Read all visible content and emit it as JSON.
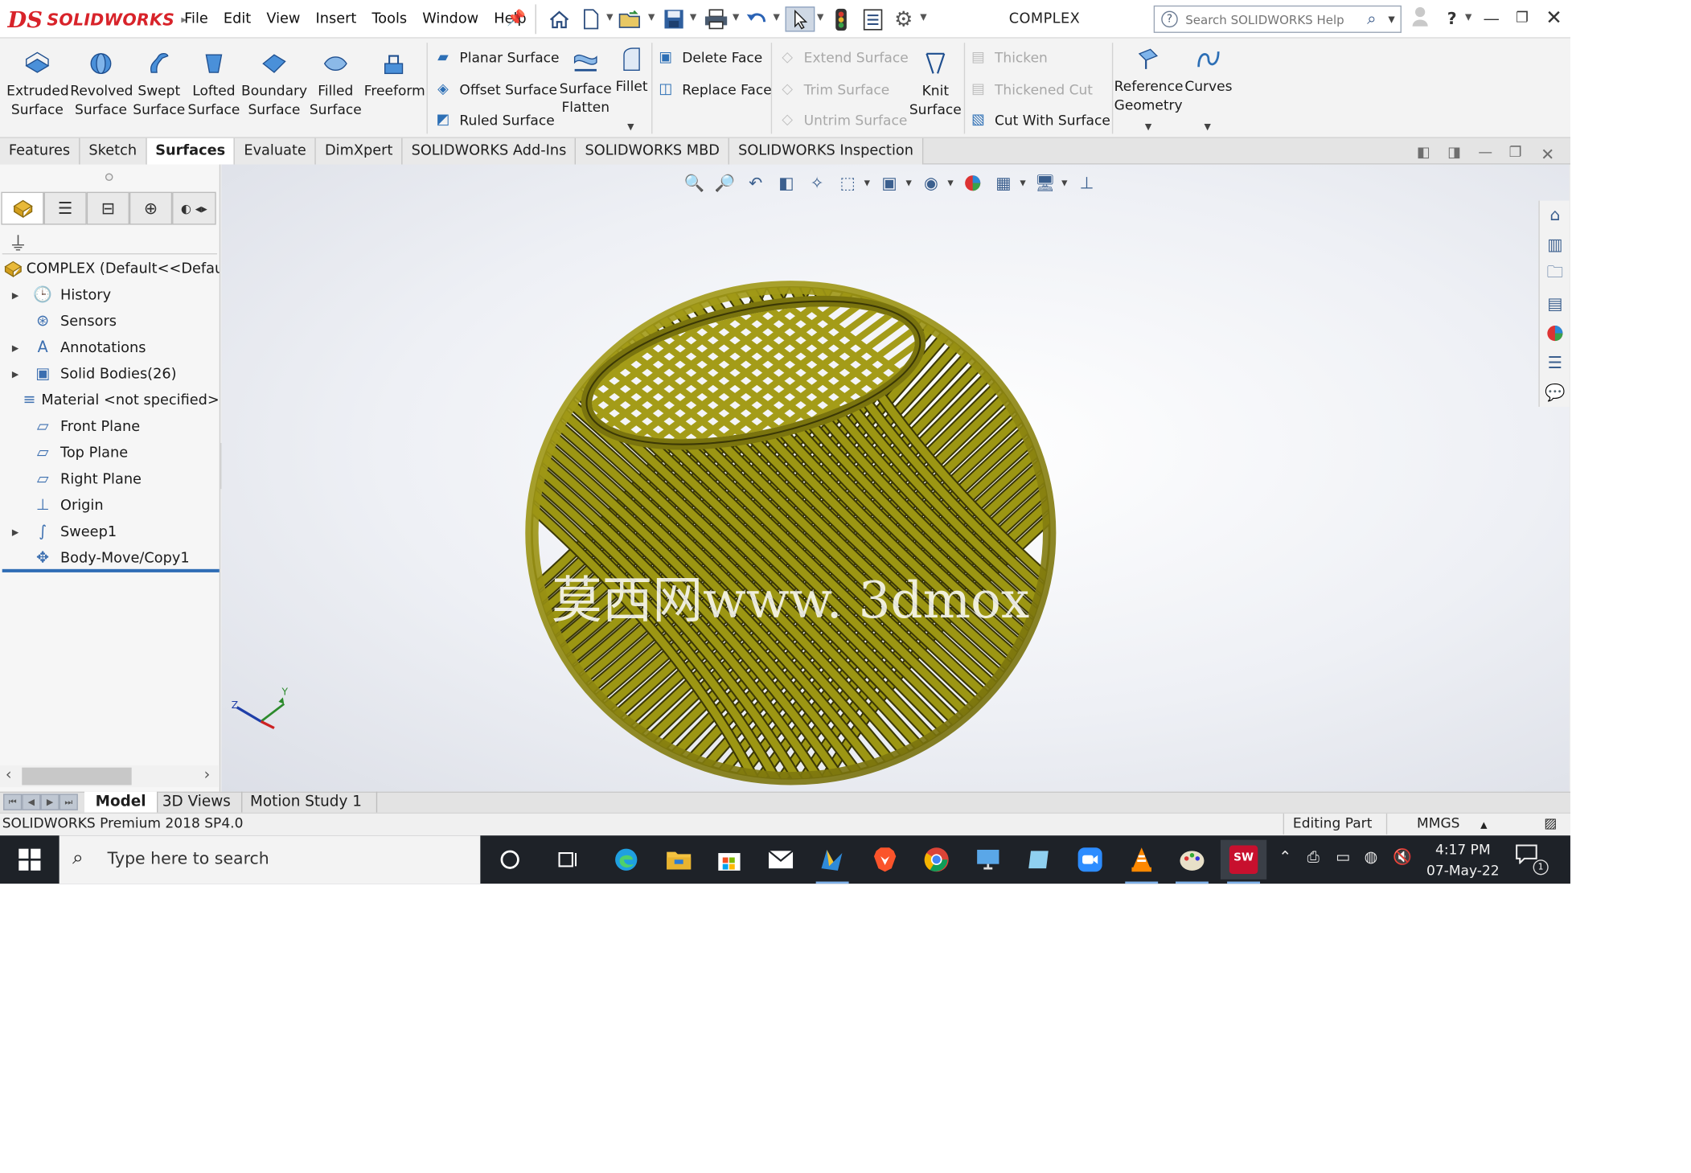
{
  "colors": {
    "brand_red": "#d8232a",
    "model_fill": "#9c9613",
    "model_edge": "#3b3806",
    "selection_blue": "#2f6db5",
    "taskbar": "#1e2228"
  },
  "titlebar": {
    "logo_mark": "DS",
    "logo_text": "SOLIDWORKS",
    "menu": [
      "File",
      "Edit",
      "View",
      "Insert",
      "Tools",
      "Window",
      "Help"
    ],
    "document_title": "COMPLEX",
    "search_placeholder": "Search SOLIDWORKS Help"
  },
  "quick_access_icons": [
    "home-icon",
    "new-document-icon",
    "open-icon",
    "save-icon",
    "print-icon",
    "undo-icon",
    "select-icon",
    "rebuild-icon",
    "file-properties-icon",
    "options-gear-icon"
  ],
  "window_controls": [
    "user-icon",
    "help-icon",
    "minimize-icon",
    "restore-icon",
    "close-icon"
  ],
  "command_manager": {
    "big_tools": [
      {
        "label": "Extruded\nSurface",
        "icon": "extruded-surface-icon"
      },
      {
        "label": "Revolved\nSurface",
        "icon": "revolved-surface-icon"
      },
      {
        "label": "Swept\nSurface",
        "icon": "swept-surface-icon"
      },
      {
        "label": "Lofted\nSurface",
        "icon": "lofted-surface-icon"
      },
      {
        "label": "Boundary\nSurface",
        "icon": "boundary-surface-icon"
      },
      {
        "label": "Filled\nSurface",
        "icon": "filled-surface-icon"
      },
      {
        "label": "Freeform",
        "icon": "freeform-icon"
      }
    ],
    "col1": [
      "Planar Surface",
      "Offset Surface",
      "Ruled Surface"
    ],
    "surface_flatten": "Surface\nFlatten",
    "fillet": "Fillet",
    "col2": [
      "Delete Face",
      "Replace Face"
    ],
    "col3_disabled": [
      "Extend Surface",
      "Trim Surface",
      "Untrim Surface"
    ],
    "knit_surface": "Knit\nSurface",
    "col4": [
      {
        "label": "Thicken",
        "enabled": false
      },
      {
        "label": "Thickened Cut",
        "enabled": false
      },
      {
        "label": "Cut With Surface",
        "enabled": true
      }
    ],
    "reference_geometry": "Reference\nGeometry",
    "curves": "Curves"
  },
  "tabs": [
    "Features",
    "Sketch",
    "Surfaces",
    "Evaluate",
    "DimXpert",
    "SOLIDWORKS Add-Ins",
    "SOLIDWORKS MBD",
    "SOLIDWORKS Inspection"
  ],
  "active_tab": "Surfaces",
  "feature_tree": {
    "root": "COMPLEX  (Default<<Default",
    "items": [
      {
        "label": "History",
        "expandable": true,
        "icon": "history-icon"
      },
      {
        "label": "Sensors",
        "expandable": false,
        "icon": "sensors-icon"
      },
      {
        "label": "Annotations",
        "expandable": true,
        "icon": "annotations-icon"
      },
      {
        "label": "Solid Bodies(26)",
        "expandable": true,
        "icon": "solid-bodies-icon"
      },
      {
        "label": "Material <not specified>",
        "expandable": false,
        "icon": "material-icon"
      },
      {
        "label": "Front Plane",
        "expandable": false,
        "icon": "plane-icon"
      },
      {
        "label": "Top Plane",
        "expandable": false,
        "icon": "plane-icon"
      },
      {
        "label": "Right Plane",
        "expandable": false,
        "icon": "plane-icon"
      },
      {
        "label": "Origin",
        "expandable": false,
        "icon": "origin-icon"
      },
      {
        "label": "Sweep1",
        "expandable": true,
        "icon": "sweep-icon"
      },
      {
        "label": "Body-Move/Copy1",
        "expandable": false,
        "icon": "move-copy-icon"
      }
    ]
  },
  "viewport": {
    "watermark": "莫西网www. 3dmox",
    "triad_labels": {
      "y": "Y",
      "z": "Z"
    }
  },
  "bottom_tabs": [
    "Model",
    "3D Views",
    "Motion Study 1"
  ],
  "active_bottom_tab": "Model",
  "status_bar": {
    "product": "SOLIDWORKS Premium 2018 SP4.0",
    "mode": "Editing Part",
    "units": "MMGS"
  },
  "taskbar": {
    "search_placeholder": "Type here to search",
    "sw_badge": "SW",
    "time": "4:17 PM",
    "date": "07-May-22",
    "notification_count": "1"
  }
}
